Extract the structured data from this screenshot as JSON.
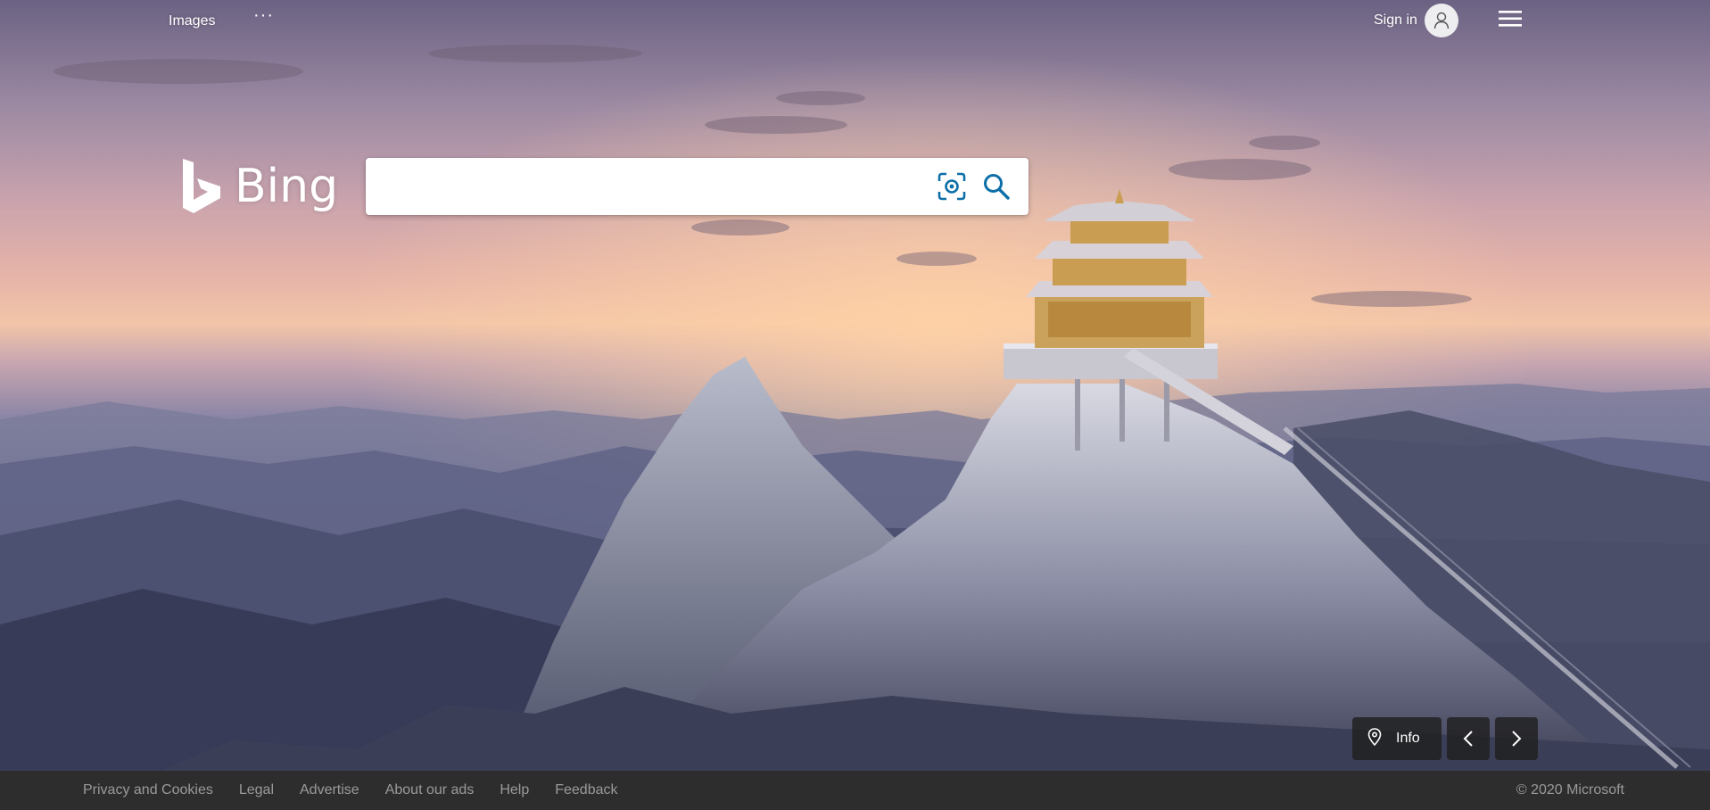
{
  "header": {
    "images_label": "Images",
    "more_label": "···",
    "sign_in_label": "Sign in"
  },
  "logo": {
    "text": "Bing"
  },
  "search": {
    "value": "",
    "placeholder": ""
  },
  "image_controls": {
    "info_label": "Info"
  },
  "footer": {
    "links": [
      "Privacy and Cookies",
      "Legal",
      "Advertise",
      "About our ads",
      "Help",
      "Feedback"
    ],
    "copyright": "© 2020 Microsoft"
  },
  "colors": {
    "search_icon": "#0c6fa8",
    "footer_bg": "#2d2d2d",
    "footer_text": "#9a9a9a"
  },
  "icons": {
    "visual_search": "camera-scan-icon",
    "search": "search-icon",
    "avatar": "user-icon",
    "menu": "hamburger-menu-icon",
    "info": "location-pin-icon",
    "prev": "chevron-left-icon",
    "next": "chevron-right-icon"
  }
}
